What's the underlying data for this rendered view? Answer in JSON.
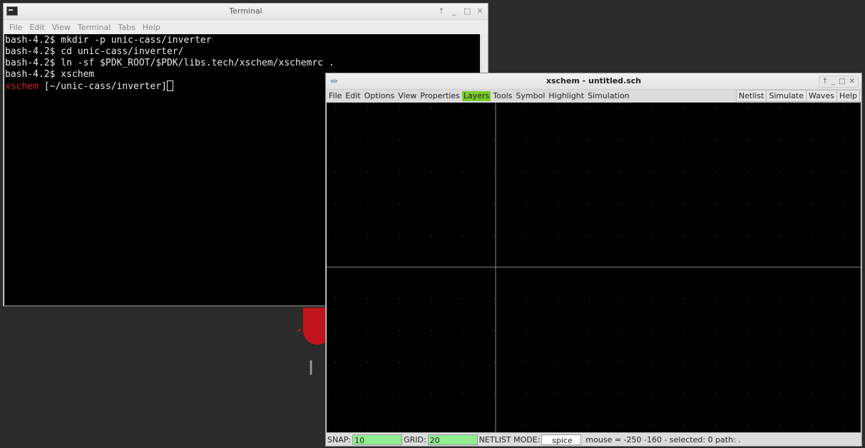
{
  "terminal": {
    "title": "Terminal",
    "menu": [
      "File",
      "Edit",
      "View",
      "Terminal",
      "Tabs",
      "Help"
    ],
    "lines": [
      "bash-4.2$ mkdir -p unic-cass/inverter",
      "bash-4.2$ cd unic-cass/inverter/",
      "bash-4.2$ ln -sf $PDK_ROOT/$PDK/libs.tech/xschem/xschemrc .",
      "bash-4.2$ xschem"
    ],
    "prompt_prefix": "xschem",
    "prompt_path": " [~/unic-cass/inverter]",
    "window_buttons": [
      "↑",
      "_",
      "□",
      "✕"
    ]
  },
  "xschem": {
    "title": "xschem - untitled.sch",
    "menu_left": [
      "File",
      "Edit",
      "Options",
      "View",
      "Properties",
      "Layers",
      "Tools",
      "Symbol",
      "Highlight",
      "Simulation"
    ],
    "active_menu": "Layers",
    "menu_right": [
      "Netlist",
      "Simulate",
      "Waves",
      "Help"
    ],
    "window_buttons": [
      "↑",
      "_",
      "□",
      "✕"
    ],
    "status": {
      "snap_label": "SNAP:",
      "snap_value": "10",
      "grid_label": "GRID:",
      "grid_value": "20",
      "netlist_label": "NETLIST MODE:",
      "netlist_value": "spice",
      "info": "mouse = -250 -160 - selected: 0 path: ."
    }
  },
  "colors": {
    "active_menu": "#7acb2a",
    "status_field": "#90ee90",
    "prompt_red": "#cc2020"
  }
}
